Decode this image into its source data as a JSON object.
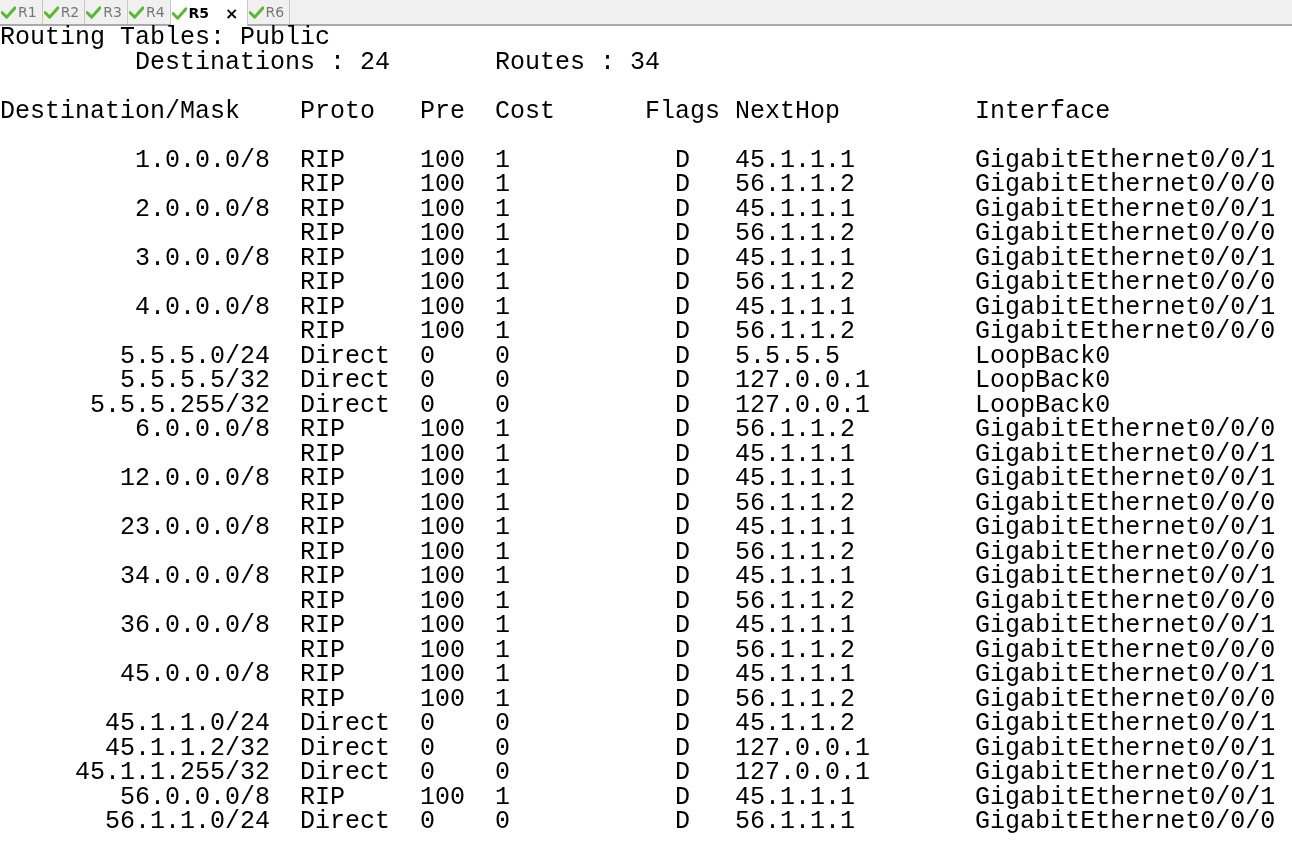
{
  "tabs": [
    {
      "label": "R1",
      "selected": false
    },
    {
      "label": "R2",
      "selected": false
    },
    {
      "label": "R3",
      "selected": false
    },
    {
      "label": "R4",
      "selected": false
    },
    {
      "label": "R5",
      "selected": true,
      "close": "×"
    },
    {
      "label": "R6",
      "selected": false
    }
  ],
  "terminal": {
    "title": "Routing Tables: Public",
    "destinations": "Destinations : 24",
    "routes": "Routes : 34",
    "columns": [
      "Destination/Mask",
      "Proto",
      "Pre",
      "Cost",
      "Flags",
      "NextHop",
      "Interface"
    ],
    "rows": [
      {
        "destination": "1.0.0.0/8",
        "proto": "RIP",
        "pre": "100",
        "cost": "1",
        "flags": "D",
        "nexthop": "45.1.1.1",
        "interface": "GigabitEthernet0/0/1"
      },
      {
        "proto": "RIP",
        "pre": "100",
        "cost": "1",
        "flags": "D",
        "nexthop": "56.1.1.2",
        "interface": "GigabitEthernet0/0/0"
      },
      {
        "destination": "2.0.0.0/8",
        "proto": "RIP",
        "pre": "100",
        "cost": "1",
        "flags": "D",
        "nexthop": "45.1.1.1",
        "interface": "GigabitEthernet0/0/1"
      },
      {
        "proto": "RIP",
        "pre": "100",
        "cost": "1",
        "flags": "D",
        "nexthop": "56.1.1.2",
        "interface": "GigabitEthernet0/0/0"
      },
      {
        "destination": "3.0.0.0/8",
        "proto": "RIP",
        "pre": "100",
        "cost": "1",
        "flags": "D",
        "nexthop": "45.1.1.1",
        "interface": "GigabitEthernet0/0/1"
      },
      {
        "proto": "RIP",
        "pre": "100",
        "cost": "1",
        "flags": "D",
        "nexthop": "56.1.1.2",
        "interface": "GigabitEthernet0/0/0"
      },
      {
        "destination": "4.0.0.0/8",
        "proto": "RIP",
        "pre": "100",
        "cost": "1",
        "flags": "D",
        "nexthop": "45.1.1.1",
        "interface": "GigabitEthernet0/0/1"
      },
      {
        "proto": "RIP",
        "pre": "100",
        "cost": "1",
        "flags": "D",
        "nexthop": "56.1.1.2",
        "interface": "GigabitEthernet0/0/0"
      },
      {
        "destination": "5.5.5.0/24",
        "proto": "Direct",
        "pre": "0",
        "cost": "0",
        "flags": "D",
        "nexthop": "5.5.5.5",
        "interface": "LoopBack0"
      },
      {
        "destination": "5.5.5.5/32",
        "proto": "Direct",
        "pre": "0",
        "cost": "0",
        "flags": "D",
        "nexthop": "127.0.0.1",
        "interface": "LoopBack0"
      },
      {
        "destination": "5.5.5.255/32",
        "proto": "Direct",
        "pre": "0",
        "cost": "0",
        "flags": "D",
        "nexthop": "127.0.0.1",
        "interface": "LoopBack0"
      },
      {
        "destination": "6.0.0.0/8",
        "proto": "RIP",
        "pre": "100",
        "cost": "1",
        "flags": "D",
        "nexthop": "56.1.1.2",
        "interface": "GigabitEthernet0/0/0"
      },
      {
        "proto": "RIP",
        "pre": "100",
        "cost": "1",
        "flags": "D",
        "nexthop": "45.1.1.1",
        "interface": "GigabitEthernet0/0/1"
      },
      {
        "destination": "12.0.0.0/8",
        "proto": "RIP",
        "pre": "100",
        "cost": "1",
        "flags": "D",
        "nexthop": "45.1.1.1",
        "interface": "GigabitEthernet0/0/1"
      },
      {
        "proto": "RIP",
        "pre": "100",
        "cost": "1",
        "flags": "D",
        "nexthop": "56.1.1.2",
        "interface": "GigabitEthernet0/0/0"
      },
      {
        "destination": "23.0.0.0/8",
        "proto": "RIP",
        "pre": "100",
        "cost": "1",
        "flags": "D",
        "nexthop": "45.1.1.1",
        "interface": "GigabitEthernet0/0/1"
      },
      {
        "proto": "RIP",
        "pre": "100",
        "cost": "1",
        "flags": "D",
        "nexthop": "56.1.1.2",
        "interface": "GigabitEthernet0/0/0"
      },
      {
        "destination": "34.0.0.0/8",
        "proto": "RIP",
        "pre": "100",
        "cost": "1",
        "flags": "D",
        "nexthop": "45.1.1.1",
        "interface": "GigabitEthernet0/0/1"
      },
      {
        "proto": "RIP",
        "pre": "100",
        "cost": "1",
        "flags": "D",
        "nexthop": "56.1.1.2",
        "interface": "GigabitEthernet0/0/0"
      },
      {
        "destination": "36.0.0.0/8",
        "proto": "RIP",
        "pre": "100",
        "cost": "1",
        "flags": "D",
        "nexthop": "45.1.1.1",
        "interface": "GigabitEthernet0/0/1"
      },
      {
        "proto": "RIP",
        "pre": "100",
        "cost": "1",
        "flags": "D",
        "nexthop": "56.1.1.2",
        "interface": "GigabitEthernet0/0/0"
      },
      {
        "destination": "45.0.0.0/8",
        "proto": "RIP",
        "pre": "100",
        "cost": "1",
        "flags": "D",
        "nexthop": "45.1.1.1",
        "interface": "GigabitEthernet0/0/1"
      },
      {
        "proto": "RIP",
        "pre": "100",
        "cost": "1",
        "flags": "D",
        "nexthop": "56.1.1.2",
        "interface": "GigabitEthernet0/0/0"
      },
      {
        "destination": "45.1.1.0/24",
        "proto": "Direct",
        "pre": "0",
        "cost": "0",
        "flags": "D",
        "nexthop": "45.1.1.2",
        "interface": "GigabitEthernet0/0/1"
      },
      {
        "destination": "45.1.1.2/32",
        "proto": "Direct",
        "pre": "0",
        "cost": "0",
        "flags": "D",
        "nexthop": "127.0.0.1",
        "interface": "GigabitEthernet0/0/1"
      },
      {
        "destination": "45.1.1.255/32",
        "proto": "Direct",
        "pre": "0",
        "cost": "0",
        "flags": "D",
        "nexthop": "127.0.0.1",
        "interface": "GigabitEthernet0/0/1"
      },
      {
        "destination": "56.0.0.0/8",
        "proto": "RIP",
        "pre": "100",
        "cost": "1",
        "flags": "D",
        "nexthop": "45.1.1.1",
        "interface": "GigabitEthernet0/0/1"
      },
      {
        "destination": "56.1.1.0/24",
        "proto": "Direct",
        "pre": "0",
        "cost": "0",
        "flags": "D",
        "nexthop": "56.1.1.1",
        "interface": "GigabitEthernet0/0/0"
      }
    ]
  }
}
